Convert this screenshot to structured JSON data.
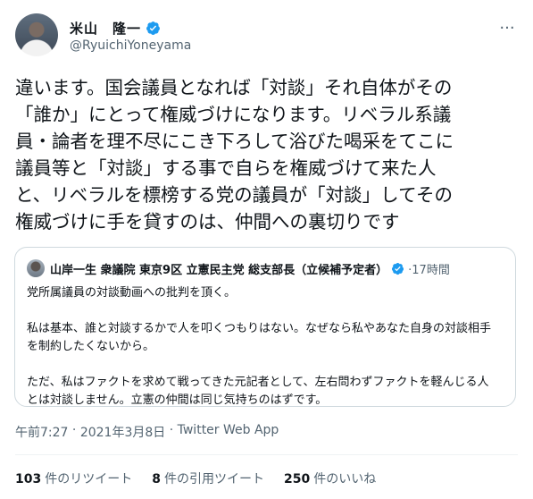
{
  "author": {
    "display_name": "米山　隆一",
    "handle": "@RyuichiYoneyama"
  },
  "more_icon": "more-dots-icon",
  "tweet": {
    "text": "違います。国会議員となれば「対談」それ自体がその\n「誰か」にとって権威づけになります。リベラル系議\n員・論者を理不尽にこき下ろして浴びた喝采をてこに\n議員等と「対談」する事で自らを権威づけて来た人\nと、リベラルを標榜する党の議員が「対談」してその\n権威づけに手を貸すのは、仲間への裏切りです"
  },
  "quote": {
    "author": "山岸一生 衆議院 東京9区 立憲民主党 総支部長（立候補予定者）",
    "meta": "·17時間",
    "body": "党所属議員の対談動画への批判を頂く。\n\n私は基本、誰と対談するかで人を叩くつもりはない。なぜなら私やあなた自身の対談相手を制約したくないから。\n\nただ、私はファクトを求めて戦ってきた元記者として、左右問わずファクトを軽んじる人とは対談しません。立憲の仲間は同じ気持ちのはずです。"
  },
  "timestamp": {
    "time": "午前7:27",
    "separator": " · ",
    "date": "2021年3月8日",
    "source": "Twitter Web App"
  },
  "stats": [
    {
      "count": "103",
      "label": "件のリツイート"
    },
    {
      "count": "8",
      "label": "件の引用ツイート"
    },
    {
      "count": "250",
      "label": "件のいいね"
    }
  ],
  "colors": {
    "verified": "#1d9bf0",
    "secondary_text": "#536471"
  }
}
